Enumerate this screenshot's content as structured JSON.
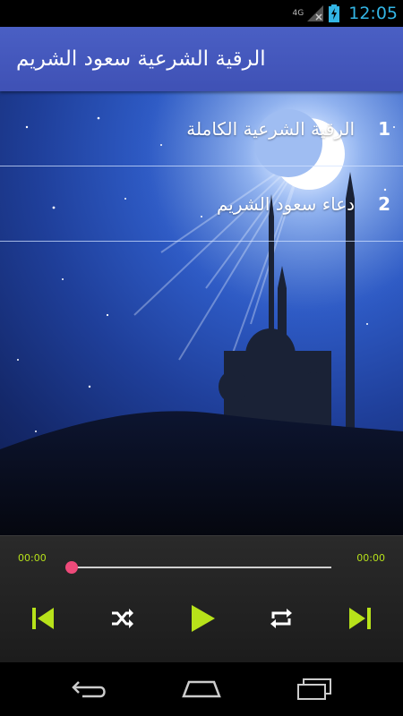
{
  "status_bar": {
    "network": "4G",
    "time": "12:05",
    "icons": [
      "signal-icon",
      "battery-charging-icon"
    ]
  },
  "action_bar": {
    "title": "الرقية الشرعية سعود الشريم"
  },
  "tracks": [
    {
      "number": "1",
      "title": "الرقية الشرعية الكاملة"
    },
    {
      "number": "2",
      "title": "دعاء سعود الشريم"
    }
  ],
  "player": {
    "current_time": "00:00",
    "duration": "00:00",
    "progress": 0,
    "controls": [
      "previous-icon",
      "shuffle-icon",
      "play-icon",
      "repeat-icon",
      "next-icon"
    ],
    "accent_color": "#b7e21a",
    "thumb_color": "#ee4a7a"
  },
  "nav_bar": {
    "icons": [
      "back-icon",
      "home-icon",
      "recent-apps-icon"
    ]
  },
  "colors": {
    "action_bar": "#3f51b5",
    "status_accent": "#33b5e5"
  }
}
